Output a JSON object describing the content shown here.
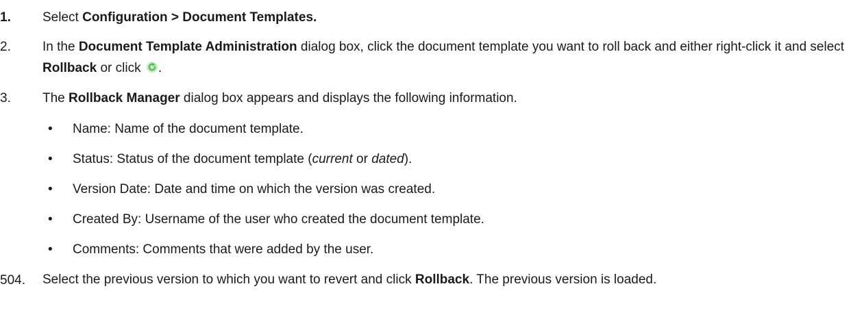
{
  "steps": [
    {
      "number": "1.",
      "parts": {
        "a": "Select ",
        "b": "Configuration > Document Templates."
      }
    },
    {
      "number": "2.",
      "parts": {
        "a": "In the ",
        "b": "Document Template Administration",
        "c": " dialog box, click the document template you want to roll back and either right-click it and select ",
        "d": "Rollback",
        "e": " or click ",
        "f": "."
      },
      "icon": "rollback-icon"
    },
    {
      "number": "3.",
      "parts": {
        "a": "The ",
        "b": "Rollback Manager",
        "c": " dialog box appears and displays the following information."
      }
    },
    {
      "number": "504.",
      "parts": {
        "a": "Select the previous version to which you want to revert and click ",
        "b": "Rollback",
        "c": ".  The previous version is loaded."
      }
    }
  ],
  "bullets": [
    {
      "text": "Name: Name of the document template."
    },
    {
      "pre": "Status: Status of the document template (",
      "em1": "current",
      "mid": " or ",
      "em2": "dated",
      "post": ")."
    },
    {
      "text": "Version Date: Date and time on which the version was created."
    },
    {
      "text": "Created By: Username of the user who created the document template."
    },
    {
      "text": "Comments: Comments that were added by the user."
    }
  ],
  "bullet_glyph": "•",
  "colors": {
    "text": "#1a1a1a",
    "icon_green": "#5cb85c",
    "icon_light": "#c8ecc0"
  }
}
